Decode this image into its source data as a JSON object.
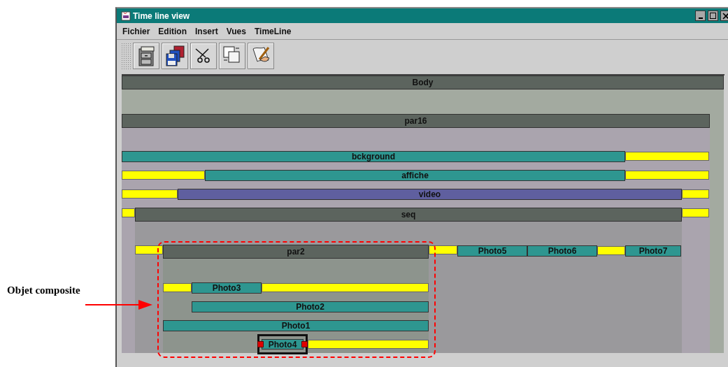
{
  "window": {
    "title": "Time line view"
  },
  "menu": [
    "Fichier",
    "Edition",
    "Insert",
    "Vues",
    "TimeLine"
  ],
  "toolbar": [
    {
      "kind": "open"
    },
    {
      "kind": "save"
    },
    {
      "kind": "cut"
    },
    {
      "kind": "copy"
    },
    {
      "kind": "edit"
    }
  ],
  "timeline": {
    "root": {
      "label": "Body",
      "kind": "group",
      "children": [
        {
          "label": "par16",
          "kind": "group",
          "children": [
            {
              "label": "bckground",
              "kind": "media",
              "color": "#2e9690",
              "selected": false
            },
            {
              "label": "affiche",
              "kind": "media",
              "color": "#2e9690",
              "selected": false
            },
            {
              "label": "video",
              "kind": "media",
              "color": "#5f5f9f",
              "selected": false
            },
            {
              "label": "seq",
              "kind": "group",
              "children": [
                {
                  "label": "par2",
                  "kind": "group",
                  "children": [
                    {
                      "label": "Photo3",
                      "kind": "media",
                      "color": "#2e9690",
                      "selected": false
                    },
                    {
                      "label": "Photo2",
                      "kind": "media",
                      "color": "#2e9690",
                      "selected": false
                    },
                    {
                      "label": "Photo1",
                      "kind": "media",
                      "color": "#2e9690",
                      "selected": false
                    },
                    {
                      "label": "Photo4",
                      "kind": "media",
                      "color": "#2e9690",
                      "selected": true
                    }
                  ]
                },
                {
                  "label": "Photo5",
                  "kind": "media",
                  "color": "#2e9690",
                  "selected": false
                },
                {
                  "label": "Photo6",
                  "kind": "media",
                  "color": "#2e9690",
                  "selected": false
                },
                {
                  "label": "Photo7",
                  "kind": "media",
                  "color": "#2e9690",
                  "selected": false
                }
              ]
            }
          ]
        }
      ]
    }
  },
  "annotation": {
    "label": "Objet composite"
  }
}
